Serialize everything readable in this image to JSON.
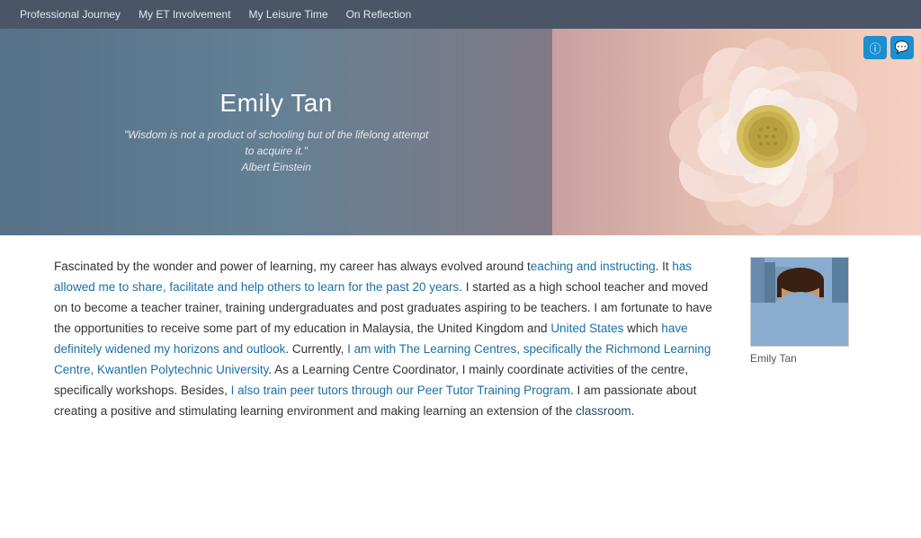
{
  "nav": {
    "items": [
      {
        "label": "Professional Journey",
        "id": "professional-journey"
      },
      {
        "label": "My ET Involvement",
        "id": "et-involvement"
      },
      {
        "label": "My Leisure Time",
        "id": "leisure-time"
      },
      {
        "label": "On Reflection",
        "id": "on-reflection"
      }
    ]
  },
  "hero": {
    "name": "Emily Tan",
    "quote": "\"Wisdom is not a product of schooling but of the lifelong attempt to acquire it.\"",
    "quote_attribution": "Albert Einstein"
  },
  "icons": {
    "info": "ⓘ",
    "chat": "💬"
  },
  "bio": {
    "text_parts": [
      {
        "text": "Fascinated by the wonder and power of learning, my career has always evolved around t",
        "type": "normal"
      },
      {
        "text": "eaching and instructing",
        "type": "highlight"
      },
      {
        "text": ". It has allowed me to share, facilitate and ",
        "type": "normal"
      },
      {
        "text": "help others to learn for the past 20 years",
        "type": "highlight"
      },
      {
        "text": ". I started as a high school teacher and moved on to become a teacher trainer, training undergraduates and post graduates aspiring to be teachers. I am fortunate to have the opportunities to receive some part of my education in Malaysia, the United Kingdom and ",
        "type": "normal"
      },
      {
        "text": "United States",
        "type": "highlight"
      },
      {
        "text": " which have definitely widened my horizons and outlook. Currently, I am with The Learning Centres, specifically the Richmond Learning Centre, Kwantlen Polytechnic University. As a Learning Centre Coordinator, I mainly coordinate activities of the centre, specifically workshops. Besides, I also ",
        "type": "normal"
      },
      {
        "text": "train peer tutors",
        "type": "highlight"
      },
      {
        "text": " through our Peer Tutor Training Program. I am passionate about creating a positive and stimulating learning environment and making learning an extension of the classroom.",
        "type": "normal"
      }
    ]
  },
  "profile": {
    "caption": "Emily Tan"
  }
}
